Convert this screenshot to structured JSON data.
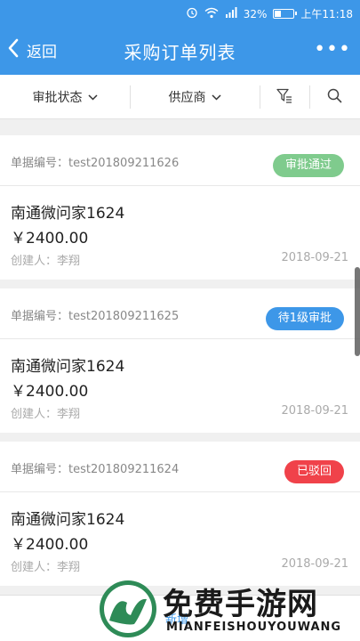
{
  "status_bar": {
    "battery_percent": "32%",
    "battery_level": 0.32,
    "time": "上午11:18",
    "icons": [
      "alarm-icon",
      "wifi-icon",
      "signal-icon",
      "battery-icon"
    ]
  },
  "nav": {
    "back_label": "返回",
    "title": "采购订单列表",
    "more_label": "•••"
  },
  "filters": {
    "status_label": "审批状态",
    "supplier_label": "供应商"
  },
  "orders": [
    {
      "order_no": "单据编号：test201809211626",
      "status": "审批通过",
      "status_color": "#7fcb8d",
      "supplier": "南通微问家1624",
      "amount": "￥2400.00",
      "creator": "创建人：李翔",
      "date": "2018-09-21"
    },
    {
      "order_no": "单据编号：test201809211625",
      "status": "待1级审批",
      "status_color": "#3d97e8",
      "supplier": "南通微问家1624",
      "amount": "￥2400.00",
      "creator": "创建人：李翔",
      "date": "2018-09-21"
    },
    {
      "order_no": "单据编号：test201809211624",
      "status": "已驳回",
      "status_color": "#f0424a",
      "supplier": "南通微问家1624",
      "amount": "￥2400.00",
      "creator": "创建人：李翔",
      "date": "2018-09-21"
    }
  ],
  "bottom": {
    "add_label": "新增"
  },
  "watermark": {
    "title": "免费手游网",
    "subtitle": "MIANFEISHOUYOUWANG"
  },
  "colors": {
    "primary": "#3d97e8",
    "approved": "#7fcb8d",
    "pending": "#3d97e8",
    "rejected": "#f0424a"
  }
}
